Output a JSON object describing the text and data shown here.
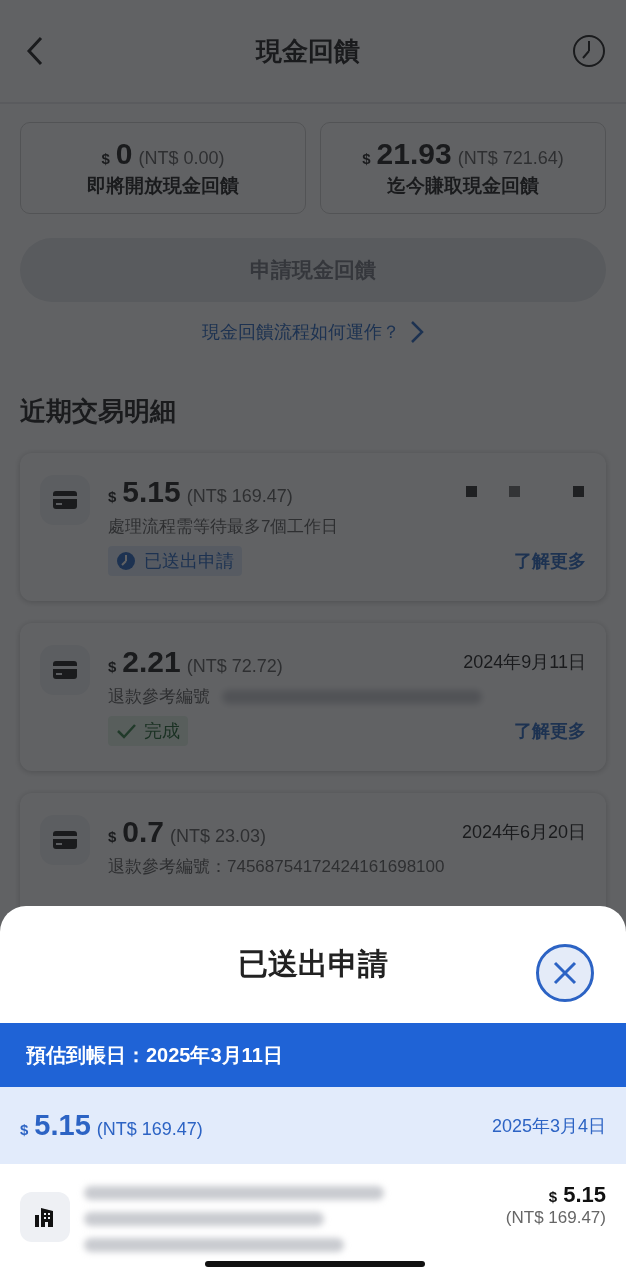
{
  "header": {
    "title": "現金回饋"
  },
  "summary": [
    {
      "currency": "$",
      "amount": "0",
      "converted": "(NT$ 0.00)",
      "label": "即將開放現金回饋"
    },
    {
      "currency": "$",
      "amount": "21.93",
      "converted": "(NT$ 721.64)",
      "label": "迄今賺取現金回饋"
    }
  ],
  "request_button": {
    "label": "申請現金回饋",
    "disabled": true
  },
  "how_link": "現金回饋流程如何運作？",
  "section_title": "近期交易明細",
  "transactions": [
    {
      "currency": "$",
      "amount": "5.15",
      "converted": "(NT$ 169.47)",
      "date_hidden": true,
      "note": "處理流程需等待最多7個工作日",
      "note_redacted": false,
      "status": {
        "kind": "submitted",
        "label": "已送出申請"
      },
      "more": "了解更多"
    },
    {
      "currency": "$",
      "amount": "2.21",
      "converted": "(NT$ 72.72)",
      "date": "2024年9月11日",
      "note": "退款參考編號",
      "note_redacted": true,
      "status": {
        "kind": "done",
        "label": "完成"
      },
      "more": "了解更多"
    },
    {
      "currency": "$",
      "amount": "0.7",
      "converted": "(NT$ 23.03)",
      "date": "2024年6月20日",
      "note": "退款參考編號：74568754172424161698100",
      "note_redacted": false
    }
  ],
  "sheet": {
    "title": "已送出申請",
    "banner": "預估到帳日：2025年3月11日",
    "summary": {
      "currency": "$",
      "amount": "5.15",
      "converted": "(NT$ 169.47)",
      "date": "2025年3月4日"
    },
    "item": {
      "currency": "$",
      "amount": "5.15",
      "converted": "(NT$ 169.47)"
    }
  }
}
